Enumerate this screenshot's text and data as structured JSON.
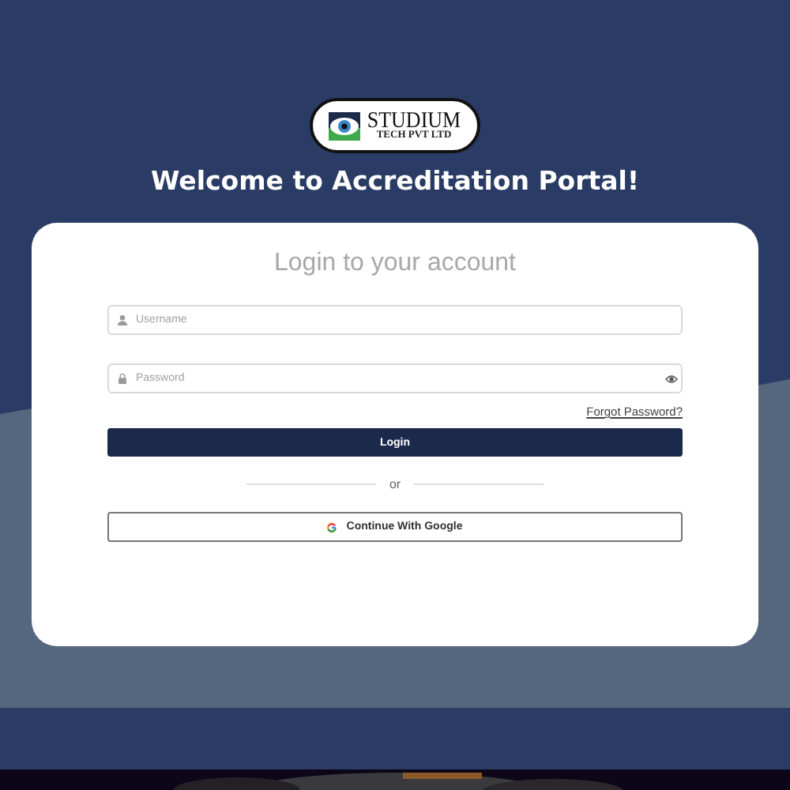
{
  "logo": {
    "name": "STUDIUM",
    "tagline": "TECH PVT LTD"
  },
  "title": "Welcome to Accreditation Portal!",
  "login_card": {
    "heading": "Login to your account",
    "fields": [
      {
        "kind": "username",
        "placeholder": "Username"
      },
      {
        "kind": "password",
        "placeholder": "Password"
      }
    ],
    "forgot_link": "Forgot Password?",
    "login_button": "Login",
    "divider": "or",
    "google_button": "Continue With Google"
  }
}
